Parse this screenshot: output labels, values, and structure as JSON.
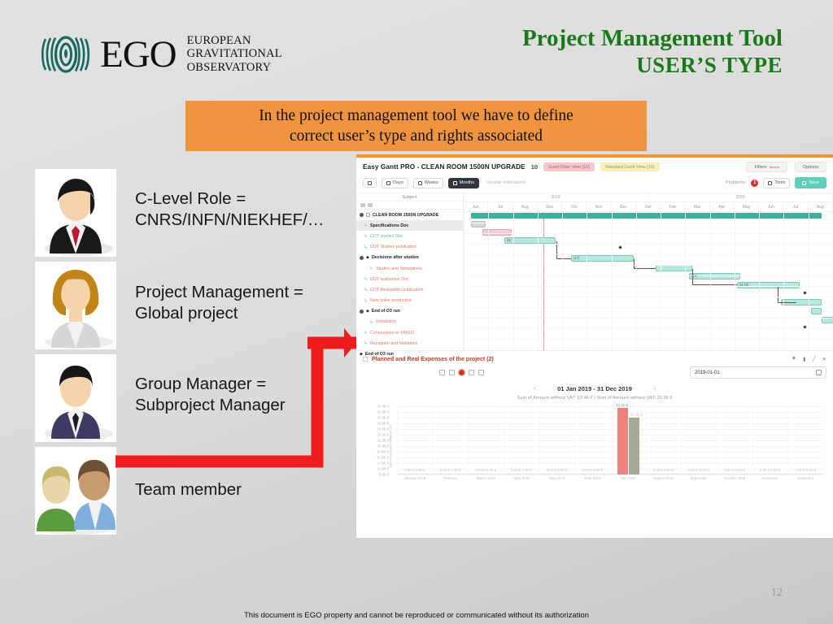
{
  "brand": {
    "name": "EGO",
    "lines": [
      "EUROPEAN",
      "GRAVITATIONAL",
      "OBSERVATORY"
    ],
    "logo_icon": "ego-waves-logo",
    "color": "#16695f"
  },
  "title": {
    "line1": "Project Management Tool",
    "line2": "USER’S TYPE",
    "color": "#1a7a1a"
  },
  "callout": {
    "line1": "In the project management tool we have to define",
    "line2": "correct user’s type and rights associated",
    "background": "#f0943f"
  },
  "roles": [
    {
      "avatar": "businessman-black-suit-avatar",
      "line1": "C-Level Role =",
      "line2": "CNRS/INFN/NIEKHEF/…"
    },
    {
      "avatar": "businesswoman-avatar",
      "line1": "Project Management =",
      "line2": "Global project"
    },
    {
      "avatar": "manager-navy-suit-avatar",
      "line1": "Group Manager =",
      "line2": "Subproject Manager"
    },
    {
      "avatar": "team-group-avatar",
      "line1": "Team member",
      "line2": ""
    }
  ],
  "arrow": {
    "icon": "red-elbow-arrow-icon",
    "color": "#ee1c1c"
  },
  "screenshot": {
    "gantt": {
      "app_title": "Easy Gantt PRO - CLEAN ROOM 1500N UPGRADE",
      "count": "10",
      "chips": [
        {
          "label": "Gantt Filter View (10)",
          "color": "#f3c7cd"
        },
        {
          "label": "Standard Gantt View (10)",
          "color": "#f7f0bd"
        }
      ],
      "filters_label": "Filters",
      "filters_sup": "default",
      "options_label": "Options",
      "zoom_buttons": [
        "Days",
        "Weeks",
        "Months"
      ],
      "zoom_selected": "Months",
      "disable_notifications_label": "Disable notifications",
      "problems_label": "Problems:",
      "problems_count": "1",
      "tools_label": "Tools",
      "save_label": "Save",
      "subject_header": "Subject",
      "tasks": [
        {
          "label": "CLEAN ROOM 1500N UPGRADE",
          "style": "dark",
          "indent": 0,
          "marker": "node"
        },
        {
          "label": "Specifications Doc",
          "style": "dark",
          "indent": 1,
          "marker": "arrow",
          "selected": true
        },
        {
          "label": "COT studies Doc",
          "style": "teal",
          "indent": 1,
          "marker": "arrow"
        },
        {
          "label": "COT Studies publication",
          "style": "red",
          "indent": 1,
          "marker": "arrow"
        },
        {
          "label": "Decisions after studies",
          "style": "dark",
          "indent": 0,
          "marker": "node-diamond"
        },
        {
          "label": "Studies and Simulations",
          "style": "red",
          "indent": 2,
          "marker": "arrow"
        },
        {
          "label": "COT realisation Doc",
          "style": "red",
          "indent": 1,
          "marker": "arrow"
        },
        {
          "label": "COT Realisation publication",
          "style": "red",
          "indent": 1,
          "marker": "arrow"
        },
        {
          "label": "New boiler production",
          "style": "red",
          "indent": 1,
          "marker": "arrow"
        },
        {
          "label": "End of O3 run",
          "style": "dark",
          "indent": 0,
          "marker": "node-diamond"
        },
        {
          "label": "Installation",
          "style": "red",
          "indent": 2,
          "marker": "arrow"
        },
        {
          "label": "Connections to VIRGO",
          "style": "red",
          "indent": 1,
          "marker": "arrow"
        },
        {
          "label": "Reception and Validation",
          "style": "red",
          "indent": 1,
          "marker": "arrow"
        },
        {
          "label": "End of O3 run",
          "style": "dark",
          "indent": 0,
          "marker": "diamond"
        }
      ],
      "years": [
        "2019",
        "2020"
      ],
      "months": [
        "Jun",
        "Jul",
        "Aug",
        "Sep",
        "Oct",
        "Nov",
        "Dec",
        "Jan",
        "Feb",
        "Mar",
        "Apr",
        "May",
        "Jun",
        "Jul",
        "Aug"
      ],
      "bar_labels": [
        "(6)",
        "(17)",
        "16 (13)",
        "(12)",
        "21 (9)"
      ]
    },
    "expenses": {
      "title": "Planned and Real Expenses of the project (2)",
      "date_value": "2019-01-01",
      "range": "01 Jan 2019 - 31 Dec 2019",
      "prev_icon": "chevron-left-icon",
      "next_icon": "chevron-right-icon",
      "summary": "Sum of Amount without VAT: 23.4k €  |  Sum of Amount without VAT: 20.0k €",
      "bar_label_planned": "23.4k €",
      "bar_label_real": "20.0k €"
    }
  },
  "chart_data": {
    "type": "bar",
    "title": "Planned and Real Expenses of the project (2)",
    "xlabel": "",
    "ylabel": "Sum of Amount without VAT",
    "categories": [
      "January 2019",
      "February",
      "March 2019",
      "April 2019",
      "May 2019",
      "June 2019",
      "July 2019",
      "August 2019",
      "September",
      "October 2019",
      "November",
      "December"
    ],
    "ytick_labels": [
      "24.0k €",
      "22.0k €",
      "20.0k €",
      "18.0k €",
      "16.0k €",
      "14.0k €",
      "12.0k €",
      "10.0k €",
      "8.00k €",
      "6.00k €",
      "4.00k €",
      "2.00k €",
      "0.00 €"
    ],
    "ylim": [
      0,
      24000
    ],
    "grid": true,
    "legend": "none",
    "series": [
      {
        "name": "Planned",
        "color": "#ef8181",
        "values": [
          0,
          0,
          0,
          0,
          0,
          0,
          23400,
          0,
          0,
          0,
          0,
          0
        ]
      },
      {
        "name": "Real",
        "color": "#a8a896",
        "values": [
          0,
          0,
          0,
          0,
          0,
          0,
          20000,
          0,
          0,
          0,
          0,
          0
        ]
      }
    ],
    "zero_label": "0.00 €",
    "data_labels": {
      "planned": "23.4k €",
      "real": "20.0k €"
    }
  },
  "page_number": "12",
  "footer": "This document is EGO property and cannot be reproduced or communicated without its authorization"
}
